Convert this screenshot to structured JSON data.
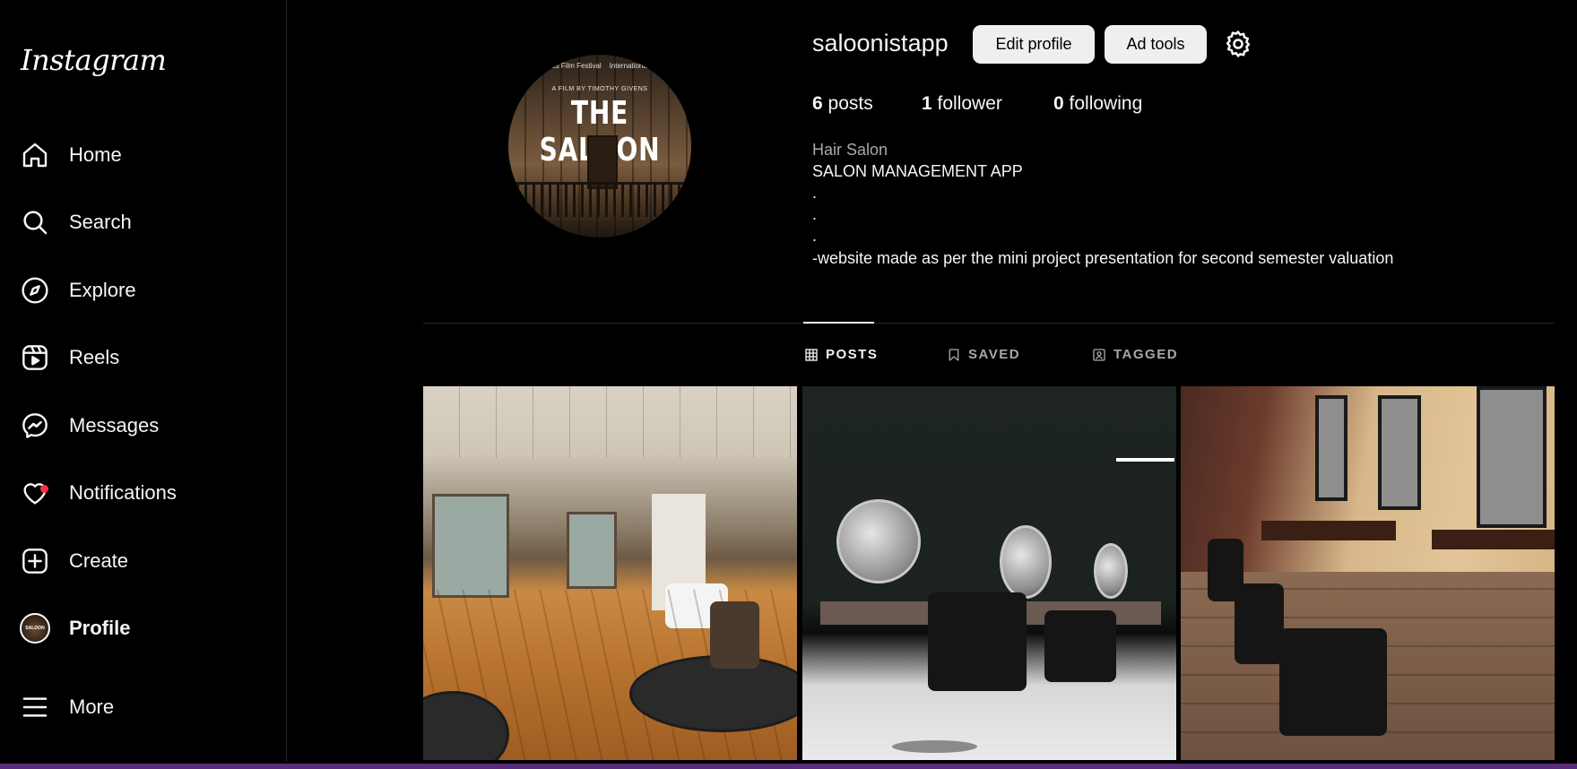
{
  "app": {
    "logo_text": "Instagram"
  },
  "sidebar": {
    "items": [
      {
        "label": "Home",
        "icon": "home-icon"
      },
      {
        "label": "Search",
        "icon": "search-icon"
      },
      {
        "label": "Explore",
        "icon": "compass-icon"
      },
      {
        "label": "Reels",
        "icon": "reels-icon"
      },
      {
        "label": "Messages",
        "icon": "messenger-icon"
      },
      {
        "label": "Notifications",
        "icon": "heart-icon",
        "has_badge": true
      },
      {
        "label": "Create",
        "icon": "plus-square-icon"
      },
      {
        "label": "Profile",
        "icon": "avatar",
        "active": true
      },
      {
        "label": "More",
        "icon": "menu-icon"
      }
    ],
    "notification_badge_color": "#ff3040"
  },
  "profile": {
    "username": "saloonistapp",
    "edit_label": "Edit profile",
    "ad_tools_label": "Ad tools",
    "settings_icon": "gear-icon",
    "stats": {
      "posts_count": "6",
      "posts_label": "posts",
      "followers_count": "1",
      "followers_label": "follower",
      "following_count": "0",
      "following_label": "following"
    },
    "category": "Hair Salon",
    "bio_lines": [
      "SALON MANAGEMENT APP",
      ".",
      ".",
      ".",
      "-website made as per the mini project presentation for second semester valuation"
    ],
    "picture": {
      "laurel_left": "East Texas Film Festival",
      "laurel_right": "International Festival",
      "credit": "A FILM BY TIMOTHY GIVENS",
      "title": "THE SALOON"
    }
  },
  "tabs": [
    {
      "label": "POSTS",
      "icon": "grid-icon",
      "active": true
    },
    {
      "label": "SAVED",
      "icon": "bookmark-icon",
      "active": false
    },
    {
      "label": "TAGGED",
      "icon": "tag-user-icon",
      "active": false
    }
  ],
  "posts": [
    {
      "subject": "salon interior with wooden floor"
    },
    {
      "subject": "salon with round mirrors and black chairs"
    },
    {
      "subject": "barber stations row"
    }
  ],
  "colors": {
    "background": "#000000",
    "button_bg": "#efefef",
    "divider": "#262626",
    "muted_text": "#a8a8a8"
  }
}
